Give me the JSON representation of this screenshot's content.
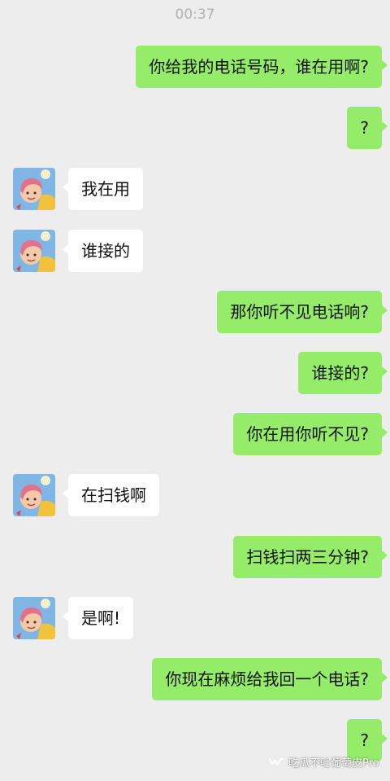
{
  "status": {
    "time": "00:37"
  },
  "colors": {
    "background": "#ededed",
    "outgoing_bubble": "#95ec69",
    "incoming_bubble": "#ffffff"
  },
  "messages": [
    {
      "sender": "me",
      "text": "你给我的电话号码，谁在用啊?"
    },
    {
      "sender": "me",
      "text": "?"
    },
    {
      "sender": "contact",
      "text": "我在用"
    },
    {
      "sender": "contact",
      "text": "谁接的"
    },
    {
      "sender": "me",
      "text": "那你听不见电话响?"
    },
    {
      "sender": "me",
      "text": "谁接的?"
    },
    {
      "sender": "me",
      "text": "你在用你听不见?"
    },
    {
      "sender": "contact",
      "text": "在扫钱啊"
    },
    {
      "sender": "me",
      "text": "扫钱扫两三分钟?"
    },
    {
      "sender": "contact",
      "text": "是啊!"
    },
    {
      "sender": "me",
      "text": "你现在麻烦给我回一个电话?"
    },
    {
      "sender": "me",
      "text": "?"
    }
  ],
  "watermark": {
    "text": "吃瓜不吐葡萄皮Pro",
    "icon": "wechat-channel-icon"
  }
}
